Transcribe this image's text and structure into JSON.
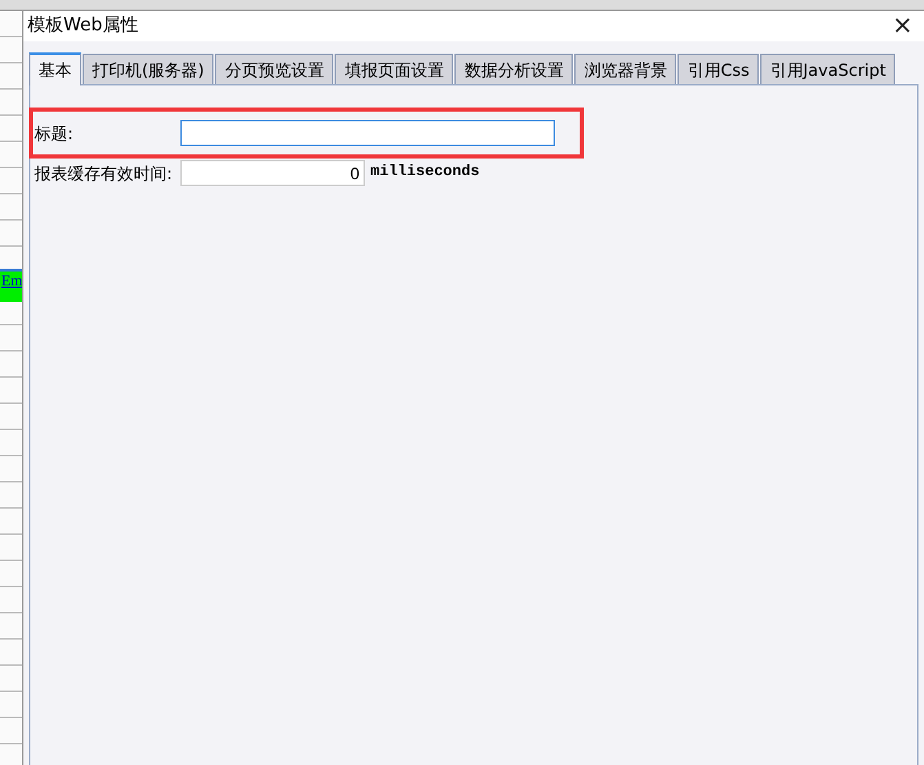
{
  "background_app": {
    "link_text": "Em"
  },
  "window": {
    "title": "模板Web属性",
    "close": "×"
  },
  "tabs": [
    {
      "label": "基本",
      "selected": true
    },
    {
      "label": "打印机(服务器)",
      "selected": false
    },
    {
      "label": "分页预览设置",
      "selected": false
    },
    {
      "label": "填报页面设置",
      "selected": false
    },
    {
      "label": "数据分析设置",
      "selected": false
    },
    {
      "label": "浏览器背景",
      "selected": false
    },
    {
      "label": "引用Css",
      "selected": false
    },
    {
      "label": "引用JavaScript",
      "selected": false
    }
  ],
  "fields": [
    {
      "label": "标题:",
      "focused": true,
      "highlighted": true,
      "kind": "text"
    },
    {
      "label": "报表缓存有效时间:",
      "value": "0",
      "unit": "milliseconds",
      "focused": false,
      "highlighted": false,
      "kind": "number"
    }
  ]
}
